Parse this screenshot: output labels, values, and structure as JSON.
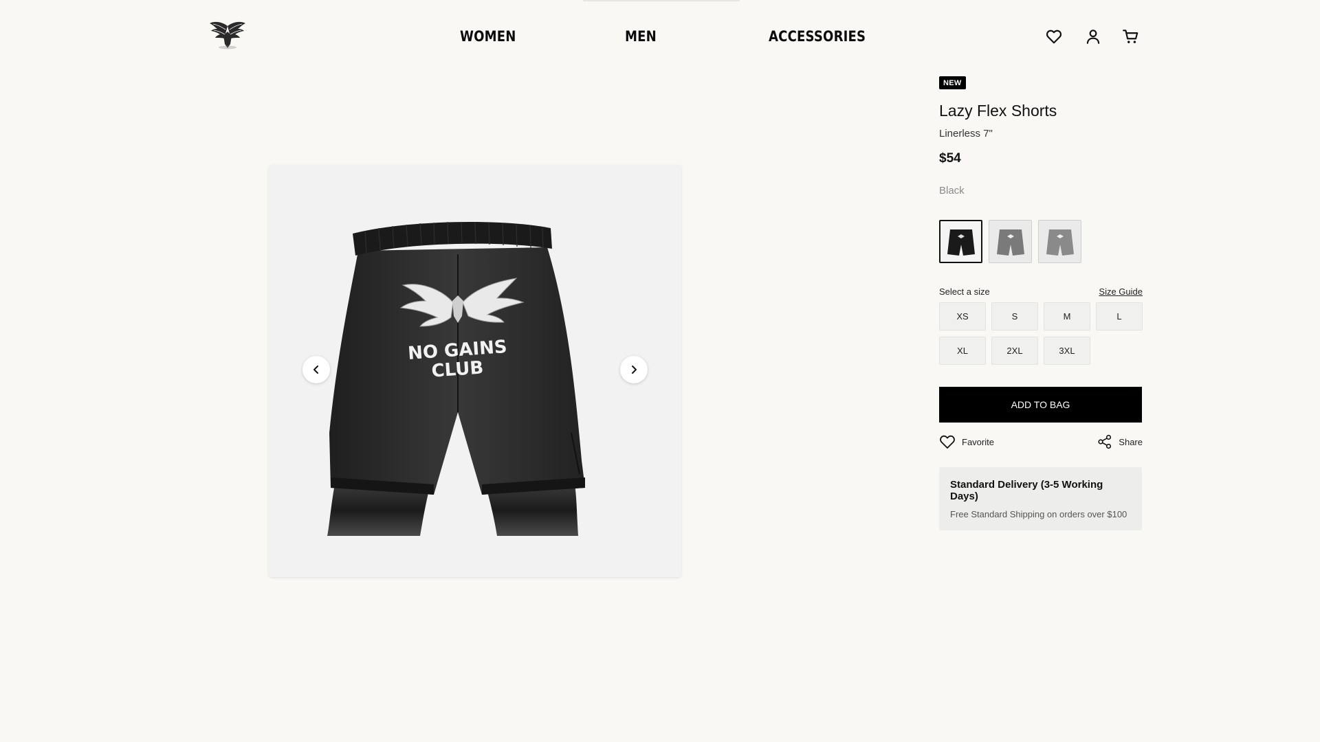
{
  "header": {
    "logo_icon": "winged-emblem-logo",
    "nav": [
      {
        "label": "WOMEN"
      },
      {
        "label": "MEN"
      },
      {
        "label": "ACCESSORIES"
      }
    ],
    "icons": [
      "heart-icon",
      "user-icon",
      "cart-icon"
    ]
  },
  "gallery": {
    "prev_icon": "chevron-left-icon",
    "next_icon": "chevron-right-icon",
    "print_line1": "NO GAINS",
    "print_line2": "CLUB"
  },
  "product": {
    "badge": "NEW",
    "title": "Lazy Flex Shorts",
    "subtitle": "Linerless 7\"",
    "price": "$54",
    "color": "Black",
    "swatches": [
      {
        "color": "#1a1a1a",
        "selected": true
      },
      {
        "color": "#7a7a7a",
        "selected": false
      },
      {
        "color": "#8a8a8a",
        "selected": false
      }
    ],
    "size_label": "Select a size",
    "size_guide": "Size Guide",
    "sizes": [
      "XS",
      "S",
      "M",
      "L",
      "XL",
      "2XL",
      "3XL"
    ],
    "add_to_bag": "ADD TO BAG",
    "favorite": "Favorite",
    "share": "Share",
    "delivery_title": "Standard Delivery (3-5 Working Days)",
    "delivery_text": "Free Standard Shipping on orders over $100"
  },
  "colors": {
    "background": "#f9f8f5",
    "primary": "#000000",
    "panel": "#ededeb"
  }
}
